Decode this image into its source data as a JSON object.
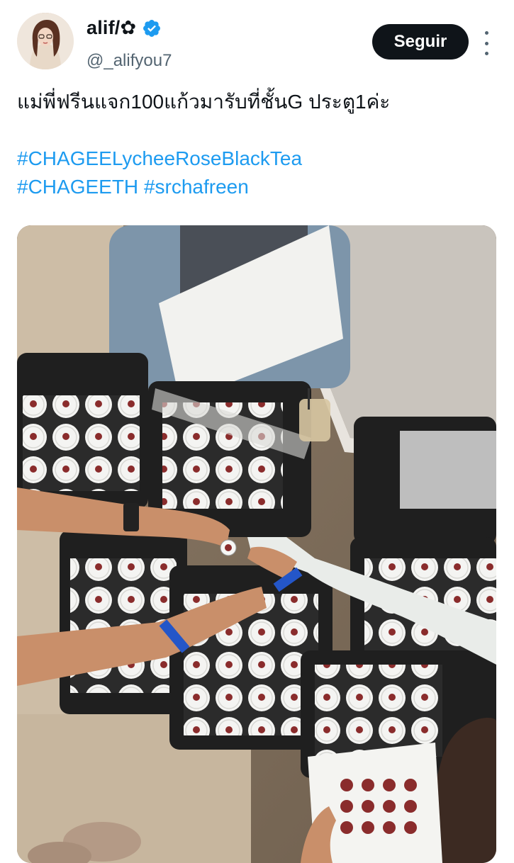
{
  "tweet": {
    "author": {
      "display_name": "alif/✿",
      "handle": "@_alifyou7",
      "verified": true
    },
    "follow_label": "Seguir",
    "text": "แม่พี่ฟรีนแจก100แก้วมารับที่ชั้นG ประตู1ค่ะ",
    "hashtags_line1": [
      "#CHAGEELycheeRoseBlackTea"
    ],
    "hashtags_line2": [
      "#CHAGEETH",
      "#srchafreen"
    ],
    "image_alt": "Bags of cups being handed out",
    "colors": {
      "link": "#1d9bf0",
      "verified": "#1d9bf0",
      "follow_bg": "#0f1419",
      "secondary_text": "#536471"
    }
  }
}
